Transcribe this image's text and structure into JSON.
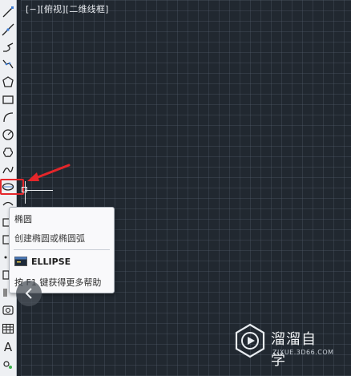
{
  "viewport": {
    "label": "[−][俯视][二维线框]"
  },
  "toolbar": {
    "tools": [
      {
        "icon": "line-icon"
      },
      {
        "icon": "construction-line-icon"
      },
      {
        "icon": "polyline-icon"
      },
      {
        "icon": "polygon-icon"
      },
      {
        "icon": "rectangle-icon"
      },
      {
        "icon": "arc-icon"
      },
      {
        "icon": "circle-icon"
      },
      {
        "icon": "revision-cloud-icon"
      },
      {
        "icon": "spline-icon"
      },
      {
        "icon": "ellipse-icon"
      },
      {
        "icon": "insert-block-icon"
      },
      {
        "icon": "table-icon"
      },
      {
        "icon": "multiline-text-icon",
        "text": "A"
      },
      {
        "icon": "add-selected-icon"
      }
    ]
  },
  "tooltip": {
    "title": "椭圆",
    "description": "创建椭圆或椭圆弧",
    "command": "ELLIPSE",
    "help": "按 F1 键获得更多帮助"
  },
  "watermark": {
    "name": "溜溜自学",
    "url": "ZIXUE.3D66.COM"
  },
  "colors": {
    "canvas": "#212830",
    "highlight": "#e5262a",
    "arrow": "#e5262a"
  }
}
